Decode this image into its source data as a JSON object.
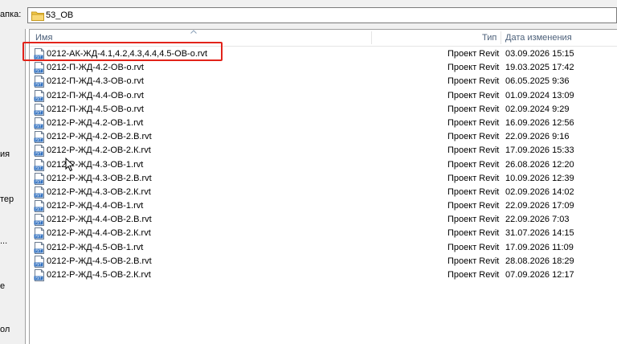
{
  "address_bar": {
    "label": "апка:",
    "path": "53_OB"
  },
  "left_pane": {
    "fragments": [
      "ия",
      "тер",
      "...",
      "е",
      "ол"
    ]
  },
  "columns": {
    "name": "Имя",
    "type": "Тип",
    "date": "Дата изменения"
  },
  "files": [
    {
      "name": "0212-АК-ЖД-4.1,4.2,4.3,4.4,4.5-ОВ-о.rvt",
      "type": "Проект Revit",
      "date": "03.09.2026 15:15"
    },
    {
      "name": "0212-П-ЖД-4.2-ОВ-о.rvt",
      "type": "Проект Revit",
      "date": "19.03.2025 17:42"
    },
    {
      "name": "0212-П-ЖД-4.3-ОВ-о.rvt",
      "type": "Проект Revit",
      "date": "06.05.2025 9:36"
    },
    {
      "name": "0212-П-ЖД-4.4-ОВ-о.rvt",
      "type": "Проект Revit",
      "date": "01.09.2024 13:09"
    },
    {
      "name": "0212-П-ЖД-4.5-ОВ-о.rvt",
      "type": "Проект Revit",
      "date": "02.09.2024 9:29"
    },
    {
      "name": "0212-Р-ЖД-4.2-ОВ-1.rvt",
      "type": "Проект Revit",
      "date": "16.09.2026 12:56"
    },
    {
      "name": "0212-Р-ЖД-4.2-ОВ-2.В.rvt",
      "type": "Проект Revit",
      "date": "22.09.2026 9:16"
    },
    {
      "name": "0212-Р-ЖД-4.2-ОВ-2.К.rvt",
      "type": "Проект Revit",
      "date": "17.09.2026 15:33"
    },
    {
      "name": "0212-Р-ЖД-4.3-ОВ-1.rvt",
      "type": "Проект Revit",
      "date": "26.08.2026 12:20"
    },
    {
      "name": "0212-Р-ЖД-4.3-ОВ-2.В.rvt",
      "type": "Проект Revit",
      "date": "10.09.2026 12:39"
    },
    {
      "name": "0212-Р-ЖД-4.3-ОВ-2.К.rvt",
      "type": "Проект Revit",
      "date": "02.09.2026 14:02"
    },
    {
      "name": "0212-Р-ЖД-4.4-ОВ-1.rvt",
      "type": "Проект Revit",
      "date": "22.09.2026 17:09"
    },
    {
      "name": "0212-Р-ЖД-4.4-ОВ-2.В.rvt",
      "type": "Проект Revit",
      "date": "22.09.2026 7:03"
    },
    {
      "name": "0212-Р-ЖД-4.4-ОВ-2.К.rvt",
      "type": "Проект Revit",
      "date": "31.07.2026 14:15"
    },
    {
      "name": "0212-Р-ЖД-4.5-ОВ-1.rvt",
      "type": "Проект Revit",
      "date": "17.09.2026 11:09"
    },
    {
      "name": "0212-Р-ЖД-4.5-ОВ-2.В.rvt",
      "type": "Проект Revit",
      "date": "28.08.2026 18:29"
    },
    {
      "name": "0212-Р-ЖД-4.5-ОВ-2.К.rvt",
      "type": "Проект Revit",
      "date": "07.09.2026 12:17"
    }
  ],
  "icons": {
    "file_icon": "revit-file-icon",
    "folder_icon": "folder-icon",
    "file_badge": "RVT"
  },
  "colors": {
    "highlight": "#e2231a",
    "header_text": "#4c607a",
    "revit_blue": "#2f6fbf",
    "folder_yellow": "#f2c94c"
  }
}
